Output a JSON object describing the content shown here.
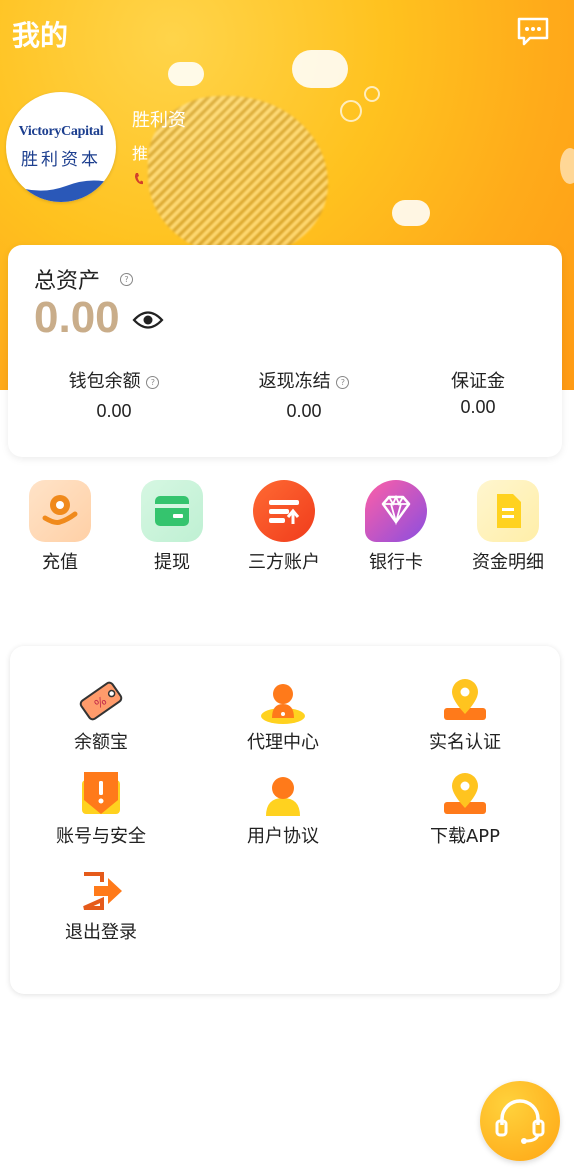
{
  "header": {
    "title": "我的",
    "message_icon": "message-icon"
  },
  "profile": {
    "brand_en": "VictoryCapital",
    "brand_cn": "胜利资本",
    "name": "胜利资",
    "sub": "推"
  },
  "assets": {
    "label": "总资产",
    "value": "0.00",
    "items": [
      {
        "label": "钱包余额",
        "value": "0.00"
      },
      {
        "label": "返现冻结",
        "value": "0.00"
      },
      {
        "label": "保证金",
        "value": "0.00"
      }
    ]
  },
  "shortcuts": [
    {
      "label": "充值",
      "icon": "recharge-icon"
    },
    {
      "label": "提现",
      "icon": "withdraw-icon"
    },
    {
      "label": "三方账户",
      "icon": "third-party-account-icon"
    },
    {
      "label": "银行卡",
      "icon": "bank-card-icon"
    },
    {
      "label": "资金明细",
      "icon": "fund-details-icon"
    }
  ],
  "menu": [
    {
      "label": "余额宝",
      "icon": "balance-treasure-icon"
    },
    {
      "label": "代理中心",
      "icon": "agent-center-icon"
    },
    {
      "label": "实名认证",
      "icon": "real-name-auth-icon"
    },
    {
      "label": "账号与安全",
      "icon": "account-security-icon"
    },
    {
      "label": "用户协议",
      "icon": "user-agreement-icon"
    },
    {
      "label": "下载APP",
      "icon": "download-app-icon"
    },
    {
      "label": "退出登录",
      "icon": "logout-icon"
    }
  ],
  "colors": {
    "header_gradient": "#ffc21f",
    "asset_value": "#c9ad8a",
    "accent_orange": "#ff7a1a",
    "brand_blue": "#1d3f8f"
  }
}
